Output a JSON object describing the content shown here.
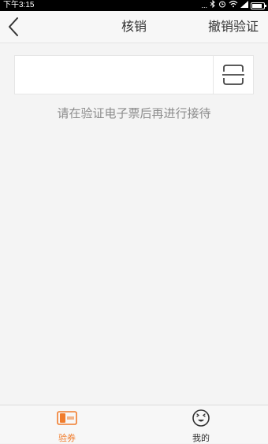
{
  "status_bar": {
    "time": "下午3:15",
    "signal_text": "...",
    "battery_level": 0.85
  },
  "nav": {
    "title": "核销",
    "revoke_label": "撤销验证",
    "back_icon": "chevron-left-icon"
  },
  "ticket_input": {
    "value": "",
    "placeholder": "",
    "scan_icon": "scan-icon"
  },
  "hint": "请在验证电子票后再进行接待",
  "tabs": [
    {
      "label": "验券",
      "icon": "ticket-icon",
      "active": true
    },
    {
      "label": "我的",
      "icon": "smiley-icon",
      "active": false
    }
  ],
  "colors": {
    "accent": "#f07c2c",
    "text": "#333333",
    "hint": "#8c8c8c",
    "background": "#f4f4f4"
  }
}
